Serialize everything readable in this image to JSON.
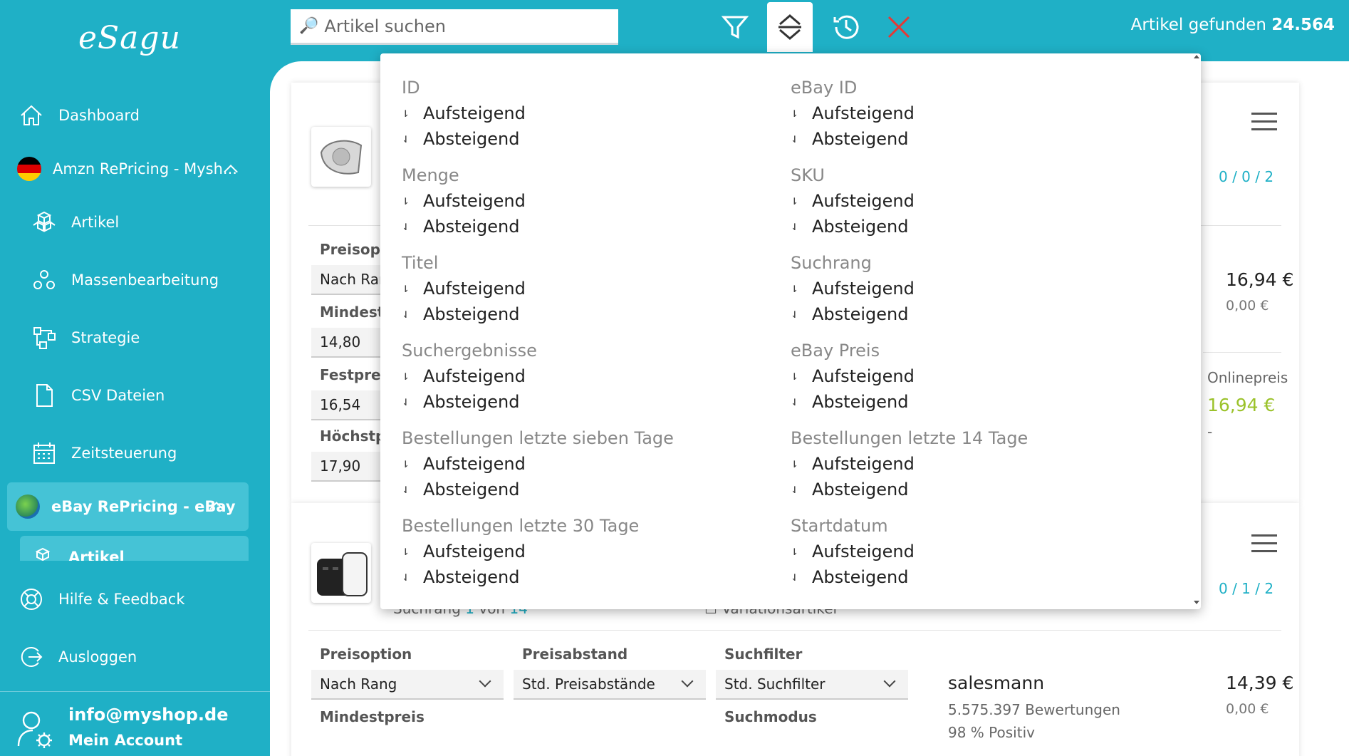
{
  "app": {
    "logo": "eSagu"
  },
  "sidebar": {
    "dashboard": "Dashboard",
    "amzn_group": "Amzn RePricing - Mysh...",
    "amzn_items": [
      "Artikel",
      "Massenbearbeitung",
      "Strategie",
      "CSV Dateien",
      "Zeitsteuerung"
    ],
    "ebay_group": "eBay RePricing - eBay",
    "ebay_active": "Artikel",
    "help": "Hilfe & Feedback",
    "logout": "Ausloggen",
    "account_email": "info@myshop.de",
    "account_label": "Mein Account"
  },
  "toolbar": {
    "search_placeholder": "Artikel suchen",
    "found_label": "Artikel gefunden",
    "found_count": "24.564",
    "close_color": "#e53935"
  },
  "sort_menu": {
    "asc_label": "Aufsteigend",
    "desc_label": "Absteigend",
    "left_groups": [
      "ID",
      "Menge",
      "Titel",
      "Suchergebnisse",
      "Bestellungen letzte sieben Tage",
      "Bestellungen letzte 30 Tage"
    ],
    "right_groups": [
      "eBay ID",
      "SKU",
      "Suchrang",
      "eBay Preis",
      "Bestellungen letzte 14 Tage",
      "Startdatum"
    ]
  },
  "card1": {
    "counts": "0 / 0 / 2",
    "labels": [
      "Preisopti",
      "Mindestp",
      "Festpreis",
      "Höchstpr"
    ],
    "values": [
      "Nach Ran",
      "14,80",
      "16,54",
      "17,90"
    ],
    "price": "16,94 €",
    "shipping": "0,00 €",
    "online_label": "Onlinepreis",
    "online_price": "16,94 €",
    "online_sub": "-"
  },
  "card2": {
    "counts": "0 / 1 / 2",
    "rank_prefix": "Suchrang",
    "rank": "1",
    "rank_of": "von",
    "rank_total": "14",
    "variation": "Variationsartikel",
    "preisoption_label": "Preisoption",
    "preisoption_value": "Nach Rang",
    "preisabstand_label": "Preisabstand",
    "preisabstand_value": "Std. Preisabstände",
    "suchfilter_label": "Suchfilter",
    "suchfilter_value": "Std. Suchfilter",
    "mindestpreis_label": "Mindestpreis",
    "suchmodus_label": "Suchmodus",
    "seller": "salesmann",
    "ratings": "5.575.397 Bewertungen",
    "positive": "98 % Positiv",
    "price": "14,39 €",
    "shipping": "0,00 €"
  }
}
